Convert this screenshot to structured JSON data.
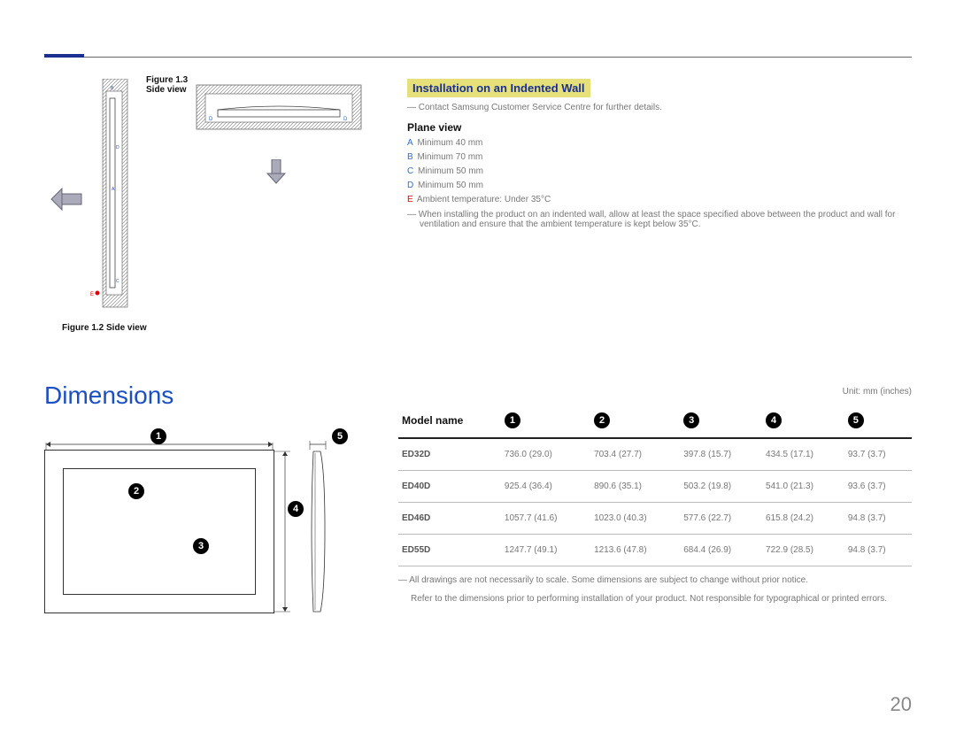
{
  "fig13_label": "Figure 1.3 Side view",
  "fig12_label": "Figure 1.2 Side view",
  "install_heading": "Installation on an Indented Wall",
  "contact_note": "― Contact Samsung Customer Service Centre for further details.",
  "plane_view_heading": "Plane view",
  "specs": {
    "a": {
      "k": "A",
      "v": "Minimum 40 mm"
    },
    "b": {
      "k": "B",
      "v": "Minimum 70 mm"
    },
    "c": {
      "k": "C",
      "v": "Minimum 50 mm"
    },
    "d": {
      "k": "D",
      "v": "Minimum 50 mm"
    },
    "e": {
      "k": "E",
      "v": "Ambient temperature: Under 35°C"
    }
  },
  "install_note": "― When installing the product on an indented wall, allow at least the space specified above between the product and wall for ventilation and ensure that the ambient temperature is kept below 35°C.",
  "dimensions_title": "Dimensions",
  "unit_label": "Unit: mm (inches)",
  "model_name_header": "Model name",
  "col_nums": [
    "1",
    "2",
    "3",
    "4",
    "5"
  ],
  "rows": [
    {
      "model": "ED32D",
      "c1": "736.0 (29.0)",
      "c2": "703.4 (27.7)",
      "c3": "397.8 (15.7)",
      "c4": "434.5 (17.1)",
      "c5": "93.7 (3.7)"
    },
    {
      "model": "ED40D",
      "c1": "925.4 (36.4)",
      "c2": "890.6 (35.1)",
      "c3": "503.2 (19.8)",
      "c4": "541.0 (21.3)",
      "c5": "93.6 (3.7)"
    },
    {
      "model": "ED46D",
      "c1": "1057.7 (41.6)",
      "c2": "1023.0 (40.3)",
      "c3": "577.6 (22.7)",
      "c4": "615.8 (24.2)",
      "c5": "94.8 (3.7)"
    },
    {
      "model": "ED55D",
      "c1": "1247.7 (49.1)",
      "c2": "1213.6 (47.8)",
      "c3": "684.4 (26.9)",
      "c4": "722.9 (28.5)",
      "c5": "94.8 (3.7)"
    }
  ],
  "footnote1": "― All drawings are not necessarily to scale. Some dimensions are subject to change without prior notice.",
  "footnote2": "Refer to the dimensions prior to performing installation of your product. Not responsible for typographical or printed errors.",
  "page_number": "20",
  "diagram_labels": {
    "a": "A",
    "b": "B",
    "c": "C",
    "d": "D",
    "e": "E"
  }
}
